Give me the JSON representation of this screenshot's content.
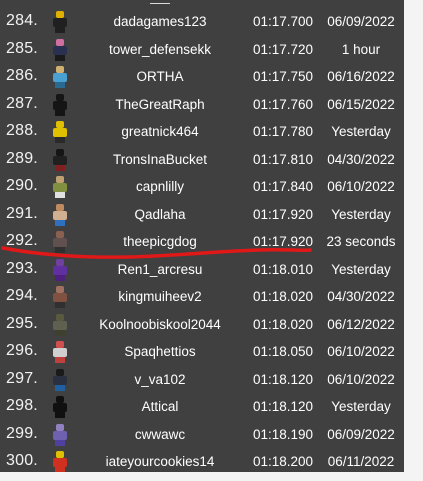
{
  "leaderboard": {
    "rows": [
      {
        "rank": "284.",
        "name": "dadagames123",
        "time": "01:17.700",
        "date": "06/09/2022",
        "avatar": {
          "head": "#e0b000",
          "body": "#202020",
          "legs": "#202020"
        }
      },
      {
        "rank": "285.",
        "name": "tower_defensekk",
        "time": "01:17.720",
        "date": "1 hour",
        "avatar": {
          "head": "#d070a0",
          "body": "#2a3050",
          "legs": "#1a1a1a"
        }
      },
      {
        "rank": "286.",
        "name": "ORTHA",
        "time": "01:17.750",
        "date": "06/16/2022",
        "avatar": {
          "head": "#d0b070",
          "body": "#4aa0d0",
          "legs": "#2a6a90"
        }
      },
      {
        "rank": "287.",
        "name": "TheGreatRaph",
        "time": "01:17.760",
        "date": "06/15/2022",
        "avatar": {
          "head": "#151515",
          "body": "#151515",
          "legs": "#151515"
        }
      },
      {
        "rank": "288.",
        "name": "greatnick464",
        "time": "01:17.780",
        "date": "Yesterday",
        "avatar": {
          "head": "#e0c000",
          "body": "#e0c000",
          "legs": "#2a2a2a"
        }
      },
      {
        "rank": "289.",
        "name": "TronsInaBucket",
        "time": "01:17.810",
        "date": "04/30/2022",
        "avatar": {
          "head": "#151515",
          "body": "#202020",
          "legs": "#802020"
        }
      },
      {
        "rank": "290.",
        "name": "capnlilly",
        "time": "01:17.840",
        "date": "06/10/2022",
        "avatar": {
          "head": "#c0a070",
          "body": "#809040",
          "legs": "#e0e0e0"
        }
      },
      {
        "rank": "291.",
        "name": "Qadlaha",
        "time": "01:17.920",
        "date": "Yesterday",
        "avatar": {
          "head": "#c08a60",
          "body": "#d0b090",
          "legs": "#3070c0"
        }
      },
      {
        "rank": "292.",
        "name": "theepicgdog",
        "time": "01:17.920",
        "date": "23 seconds",
        "avatar": {
          "head": "#8a6050",
          "body": "#605050",
          "legs": "#303030"
        }
      },
      {
        "rank": "293.",
        "name": "Ren1_arcresu",
        "time": "01:18.010",
        "date": "Yesterday",
        "avatar": {
          "head": "#7040a0",
          "body": "#6030a0",
          "legs": "#502080"
        }
      },
      {
        "rank": "294.",
        "name": "kingmuiheev2",
        "time": "01:18.020",
        "date": "04/30/2022",
        "avatar": {
          "head": "#a07060",
          "body": "#805040",
          "legs": "#303030"
        }
      },
      {
        "rank": "295.",
        "name": "Koolnoobiskool2044",
        "time": "01:18.020",
        "date": "06/12/2022",
        "avatar": {
          "head": "#5a5a40",
          "body": "#606050",
          "legs": "#404030"
        }
      },
      {
        "rank": "296.",
        "name": "Spaqhettios",
        "time": "01:18.050",
        "date": "06/10/2022",
        "avatar": {
          "head": "#d05050",
          "body": "#d0d0d0",
          "legs": "#c04040"
        }
      },
      {
        "rank": "297.",
        "name": "v_va102",
        "time": "01:18.120",
        "date": "06/10/2022",
        "avatar": {
          "head": "#1a1a1a",
          "body": "#2a3040",
          "legs": "#2060a0"
        }
      },
      {
        "rank": "298.",
        "name": "Attical",
        "time": "01:18.120",
        "date": "Yesterday",
        "avatar": {
          "head": "#101010",
          "body": "#101010",
          "legs": "#101010"
        }
      },
      {
        "rank": "299.",
        "name": "cwwawc",
        "time": "01:18.190",
        "date": "06/09/2022",
        "avatar": {
          "head": "#9080c0",
          "body": "#7060b0",
          "legs": "#5040a0"
        }
      },
      {
        "rank": "300.",
        "name": "iateyourcookies14",
        "time": "01:18.200",
        "date": "06/11/2022",
        "avatar": {
          "head": "#e0c000",
          "body": "#d03020",
          "legs": "#d03020"
        }
      }
    ]
  },
  "annotation": {
    "color": "#e01818"
  }
}
